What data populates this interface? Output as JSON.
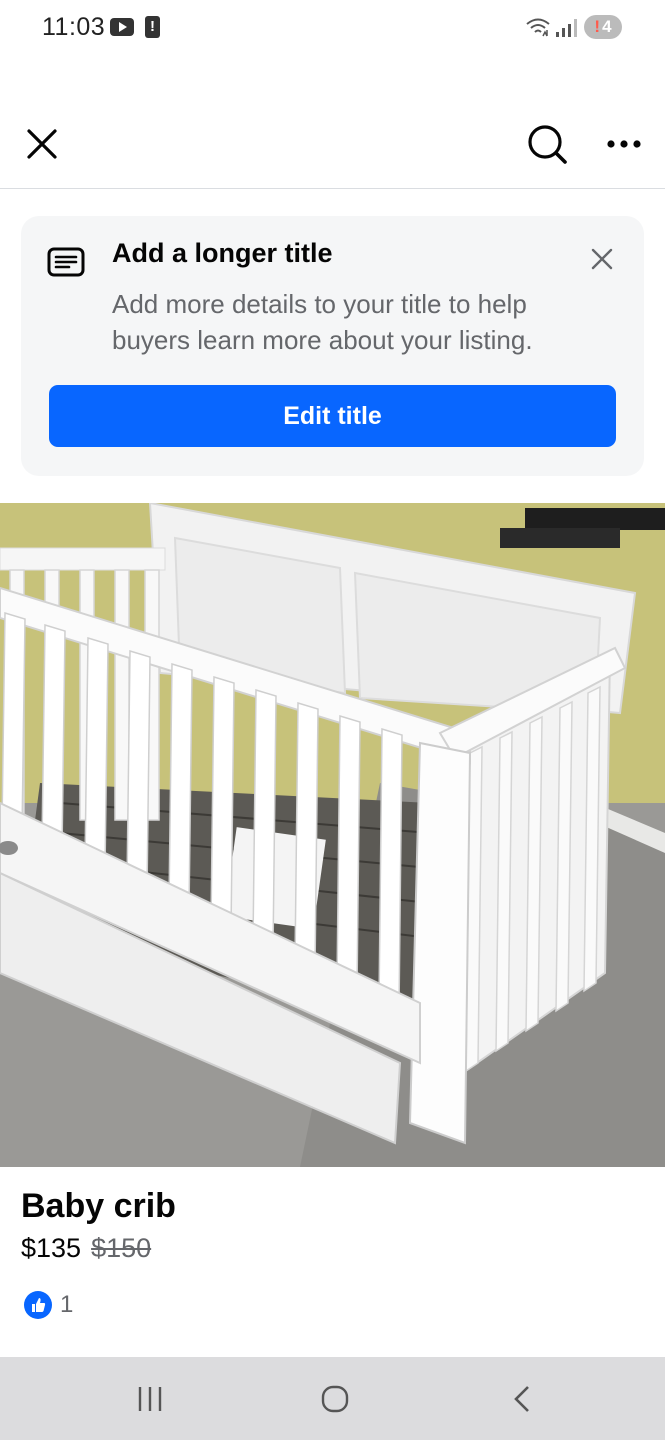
{
  "status_bar": {
    "time": "11:03",
    "notification_badge": "4",
    "icons": [
      "youtube-icon",
      "alert-icon",
      "wifi-icon",
      "signal-icon"
    ]
  },
  "top_nav": {
    "icons": [
      "close-icon",
      "search-icon",
      "more-icon"
    ]
  },
  "banner": {
    "title": "Add a longer title",
    "text": "Add more details to your title to help buyers learn more about your listing.",
    "button_label": "Edit title",
    "icon": "title-document-icon",
    "accent_color": "#0866ff"
  },
  "listing": {
    "title": "Baby crib",
    "price": "$135",
    "original_price": "$150",
    "reaction_count": "1",
    "photo_alt": "white baby crib"
  },
  "android_nav": {
    "icons": [
      "recent-apps-icon",
      "home-icon",
      "back-icon"
    ]
  }
}
